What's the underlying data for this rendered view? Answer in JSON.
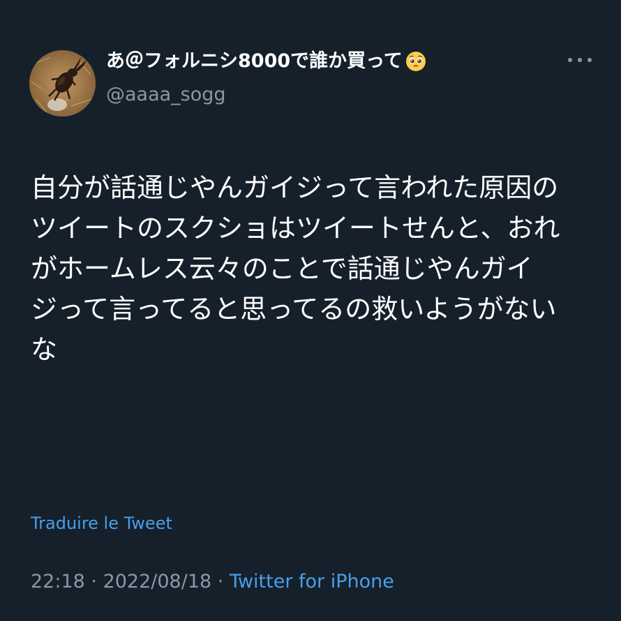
{
  "tweet": {
    "display_name": "あ＠フォルニシ8000で誰か買って",
    "display_name_emoji": "pleading-face-icon",
    "handle": "@aaaa_sogg",
    "more_icon": "more-horizontal-icon",
    "text": "自分が話通じやんガイジって言われた原因の\nツイートのスクショはツイートせんと、おれ\nがホームレス云々のことで話通じやんガイ\nジって言ってると思ってるの救いようがない\nな",
    "translate_label": "Traduire le Tweet",
    "time": "22:18",
    "separator": " · ",
    "date": "2022/08/18",
    "source": "Twitter for iPhone"
  },
  "colors": {
    "background": "#15202b",
    "primary_text": "#ffffff",
    "secondary_text": "#8b98a5",
    "link": "#4a9ee8"
  }
}
